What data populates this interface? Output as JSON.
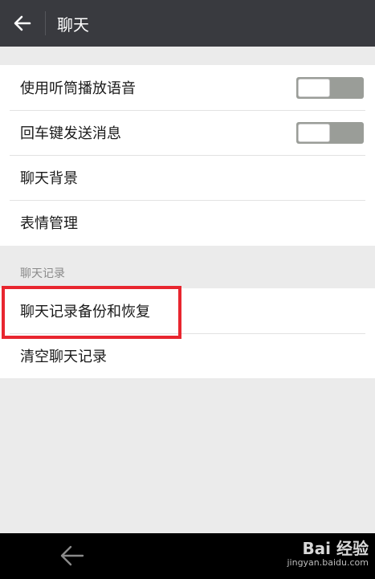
{
  "header": {
    "title": "聊天"
  },
  "group1": [
    {
      "label": "使用听筒播放语音",
      "toggle": "off"
    },
    {
      "label": "回车键发送消息",
      "toggle": "off"
    },
    {
      "label": "聊天背景"
    },
    {
      "label": "表情管理"
    }
  ],
  "section2": {
    "title": "聊天记录",
    "items": [
      {
        "label": "聊天记录备份和恢复",
        "highlighted": true
      },
      {
        "label": "清空聊天记录"
      }
    ]
  },
  "watermark": {
    "main": "Bai 经验",
    "sub": "jingyan.baidu.com"
  },
  "colors": {
    "header_bg": "#393a3f",
    "highlight": "#e8262f",
    "toggle_off": "#9a9d98"
  }
}
